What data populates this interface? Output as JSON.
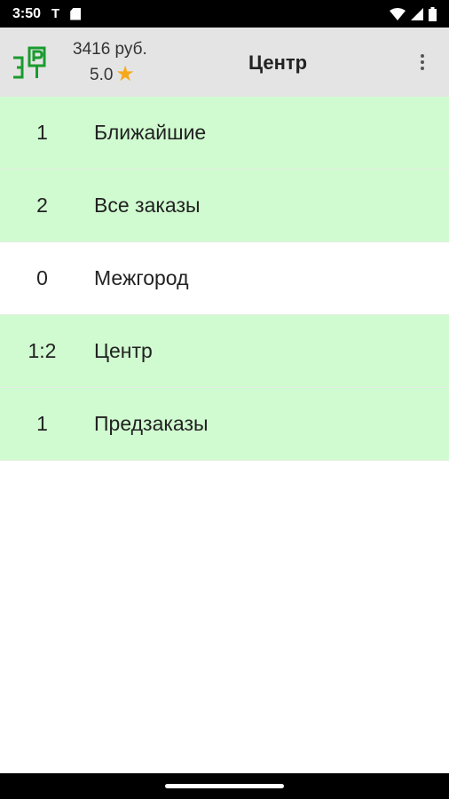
{
  "status_bar": {
    "time": "3:50",
    "carrier_glyph": "T",
    "icons": [
      "sim-card-icon",
      "wifi-icon",
      "signal-icon",
      "battery-icon"
    ]
  },
  "app_bar": {
    "balance": "3416 руб.",
    "rating": "5.0",
    "title": "Центр",
    "logo_icon": "taxi-logo-icon",
    "menu_icon": "more-vert-icon"
  },
  "colors": {
    "active_row": "#d0fbd0",
    "inactive_row": "#ffffff",
    "app_bar": "#e4e4e4",
    "star": "#f6a81c",
    "logo": "#1a9b2e"
  },
  "rows": [
    {
      "count": "1",
      "label": "Ближайшие",
      "highlighted": true
    },
    {
      "count": "2",
      "label": "Все заказы",
      "highlighted": true
    },
    {
      "count": "0",
      "label": "Межгород",
      "highlighted": false
    },
    {
      "count": "1:2",
      "label": "Центр",
      "highlighted": true
    },
    {
      "count": "1",
      "label": "Предзаказы",
      "highlighted": true
    }
  ]
}
